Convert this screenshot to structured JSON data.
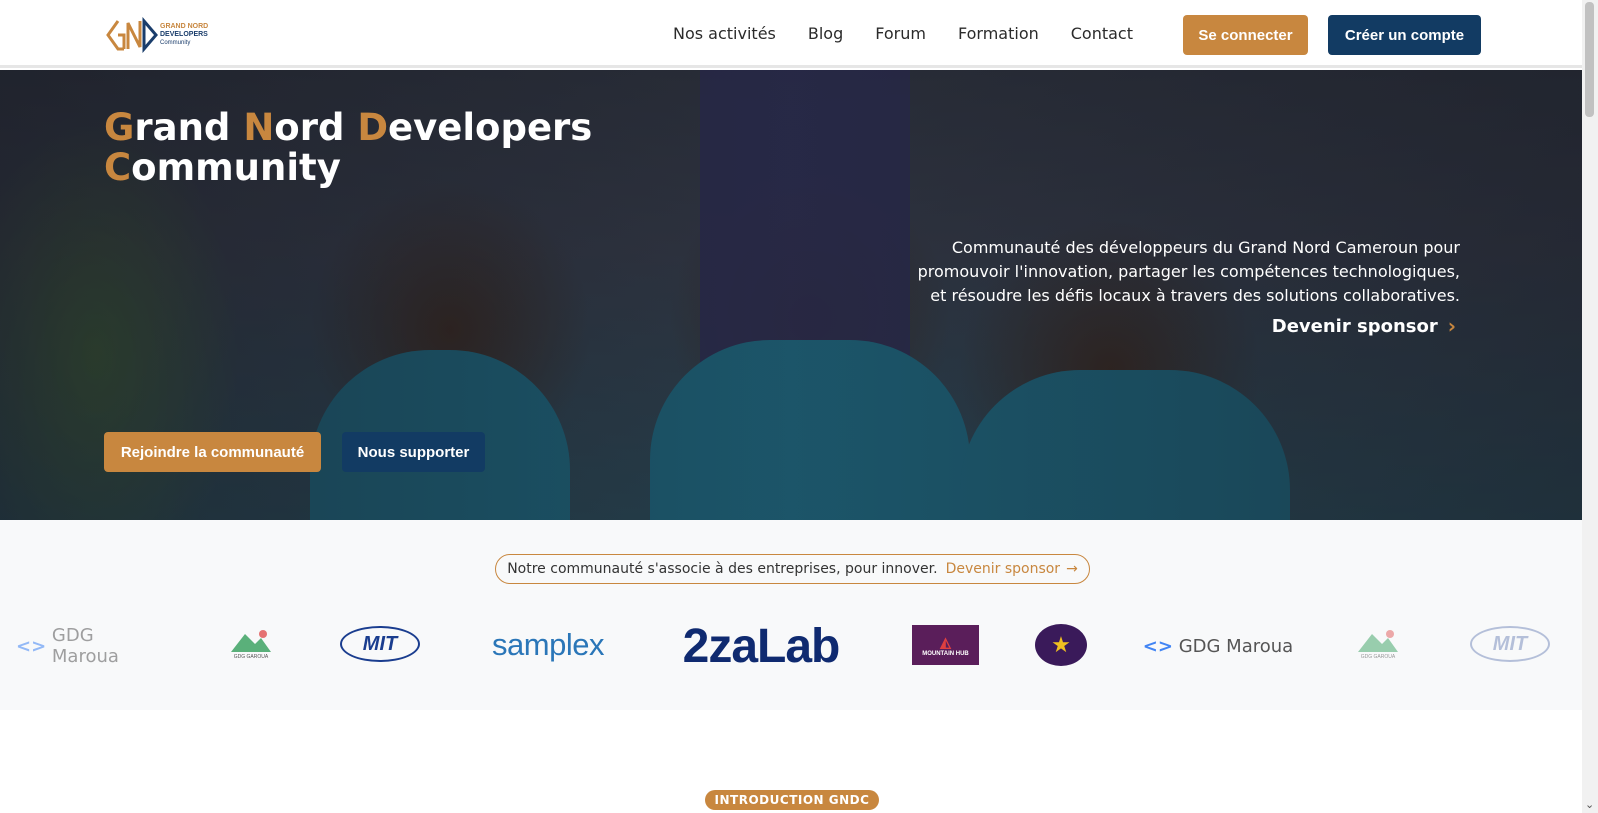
{
  "header": {
    "logo_line1": "GRAND NORD",
    "logo_line2": "DEVELOPERS",
    "logo_line3": "Community",
    "nav": [
      "Nos activités",
      "Blog",
      "Forum",
      "Formation",
      "Contact"
    ],
    "login_label": "Se connecter",
    "register_label": "Créer un compte"
  },
  "hero": {
    "title_words": [
      {
        "first": "G",
        "rest": "rand "
      },
      {
        "first": "N",
        "rest": "ord "
      },
      {
        "first": "D",
        "rest": "evelopers "
      },
      {
        "first": "C",
        "rest": "ommunity"
      }
    ],
    "description": "Communauté des développeurs du Grand Nord Cameroun pour promouvoir l'innovation, partager les compétences technologiques, et résoudre les défis locaux à travers des solutions collaboratives.",
    "sponsor_link": "Devenir sponsor",
    "join_button": "Rejoindre la communauté",
    "support_button": "Nous supporter"
  },
  "partners": {
    "pill_text": "Notre communauté s'associe à des entreprises, pour innover.",
    "pill_link": "Devenir sponsor",
    "logos": {
      "gdg_maroua": "GDG Maroua",
      "gdg_garoua": "GDG GAROUA",
      "mit": "MIT",
      "samplex": "samplex",
      "zalab": "2zaLab",
      "mountain_hub": "MOUNTAIN HUB"
    }
  },
  "intro": {
    "badge": "INTRODUCTION GNDC"
  },
  "colors": {
    "accent": "#c8873f",
    "primary": "#123b63"
  }
}
